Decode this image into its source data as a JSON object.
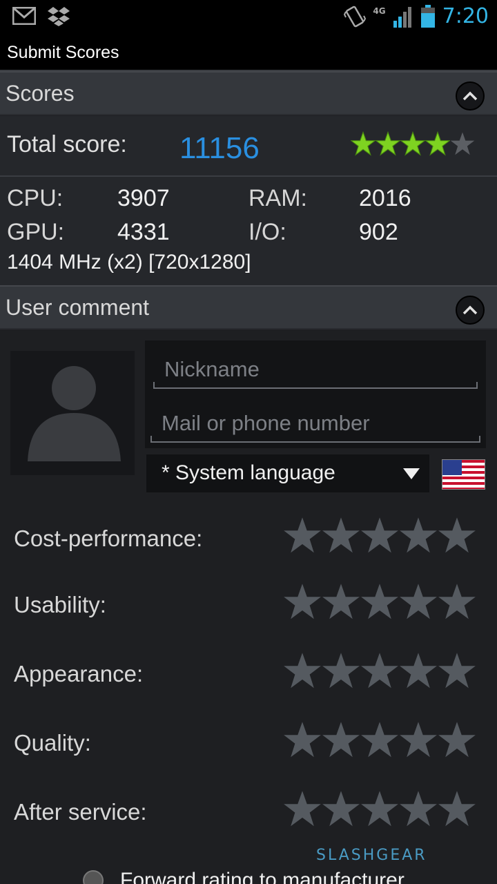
{
  "status_bar": {
    "time": "7:20",
    "network": "4G",
    "icons": [
      "gmail-icon",
      "dropbox-icon",
      "vibrate-icon",
      "signal-icon",
      "battery-icon"
    ]
  },
  "title": "Submit Scores",
  "scores": {
    "header": "Scores",
    "total_label": "Total score:",
    "total_value": "11156",
    "total_rating": 4,
    "total_rating_max": 5,
    "cpu_label": "CPU:",
    "cpu_value": "3907",
    "ram_label": "RAM:",
    "ram_value": "2016",
    "gpu_label": "GPU:",
    "gpu_value": "4331",
    "io_label": "I/O:",
    "io_value": "902",
    "info": "1404 MHz (x2) [720x1280]"
  },
  "comment": {
    "header": "User comment",
    "nickname_placeholder": "Nickname",
    "mail_placeholder": "Mail or phone number",
    "language": "* System language",
    "flag": "us-flag",
    "ratings": [
      {
        "label": "Cost-performance:",
        "value": 0
      },
      {
        "label": "Usability:",
        "value": 0
      },
      {
        "label": "Appearance:",
        "value": 0
      },
      {
        "label": "Quality:",
        "value": 0
      },
      {
        "label": "After service:",
        "value": 0
      }
    ],
    "forward_label": "Forward rating to manufacturer"
  },
  "watermark": "SLASHGEAR",
  "colors": {
    "accent": "#2a8fe0",
    "star_on": "#7ed321",
    "star_off": "#555a60"
  }
}
